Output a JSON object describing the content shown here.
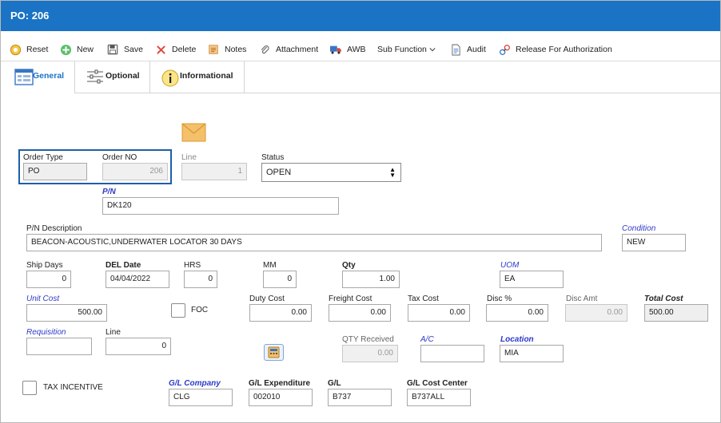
{
  "window": {
    "title": "PO: 206"
  },
  "toolbar": {
    "reset": "Reset",
    "new": "New",
    "save": "Save",
    "delete": "Delete",
    "notes": "Notes",
    "attachment": "Attachment",
    "awb": "AWB",
    "sub_function": "Sub Function",
    "audit": "Audit",
    "release": "Release For Authorization"
  },
  "tabs": {
    "general": "General",
    "optional": "Optional",
    "informational": "Informational"
  },
  "form": {
    "order_type": {
      "label": "Order Type",
      "value": "PO"
    },
    "order_no": {
      "label": "Order NO",
      "value": "206"
    },
    "line": {
      "label": "Line",
      "value": "1"
    },
    "status": {
      "label": "Status",
      "value": "OPEN"
    },
    "pn": {
      "label": "P/N",
      "value": "DK120"
    },
    "pn_desc": {
      "label": "P/N Description",
      "value": "BEACON-ACOUSTIC,UNDERWATER LOCATOR 30 DAYS"
    },
    "condition": {
      "label": "Condition",
      "value": "NEW"
    },
    "ship_days": {
      "label": "Ship Days",
      "value": "0"
    },
    "del_date": {
      "label": "DEL Date",
      "value": "04/04/2022"
    },
    "hrs": {
      "label": "HRS",
      "value": "0"
    },
    "mm": {
      "label": "MM",
      "value": "0"
    },
    "qty": {
      "label": "Qty",
      "value": "1.00"
    },
    "uom": {
      "label": "UOM",
      "value": "EA"
    },
    "unit_cost": {
      "label": "Unit Cost",
      "value": "500.00"
    },
    "foc": {
      "label": "FOC"
    },
    "duty_cost": {
      "label": "Duty Cost",
      "value": "0.00"
    },
    "freight_cost": {
      "label": "Freight Cost",
      "value": "0.00"
    },
    "tax_cost": {
      "label": "Tax Cost",
      "value": "0.00"
    },
    "disc_pct": {
      "label": "Disc %",
      "value": "0.00"
    },
    "disc_amt": {
      "label": "Disc Amt",
      "value": "0.00"
    },
    "total_cost": {
      "label": "Total Cost",
      "value": "500.00"
    },
    "requisition": {
      "label": "Requisition",
      "value": ""
    },
    "req_line": {
      "label": "Line",
      "value": "0"
    },
    "qty_received": {
      "label": "QTY Received",
      "value": "0.00"
    },
    "ac": {
      "label": "A/C",
      "value": ""
    },
    "location": {
      "label": "Location",
      "value": "MIA"
    },
    "tax_incentive": {
      "label": "TAX INCENTIVE"
    },
    "gl_company": {
      "label": "G/L Company",
      "value": "CLG"
    },
    "gl_expenditure": {
      "label": "G/L Expenditure",
      "value": "002010"
    },
    "gl": {
      "label": "G/L",
      "value": "B737"
    },
    "gl_cost_center": {
      "label": "G/L Cost Center",
      "value": "B737ALL"
    }
  },
  "colors": {
    "title_bar": "#1a73c4",
    "required_label": "#2d39c8",
    "highlight_border": "#1f5ea8"
  }
}
